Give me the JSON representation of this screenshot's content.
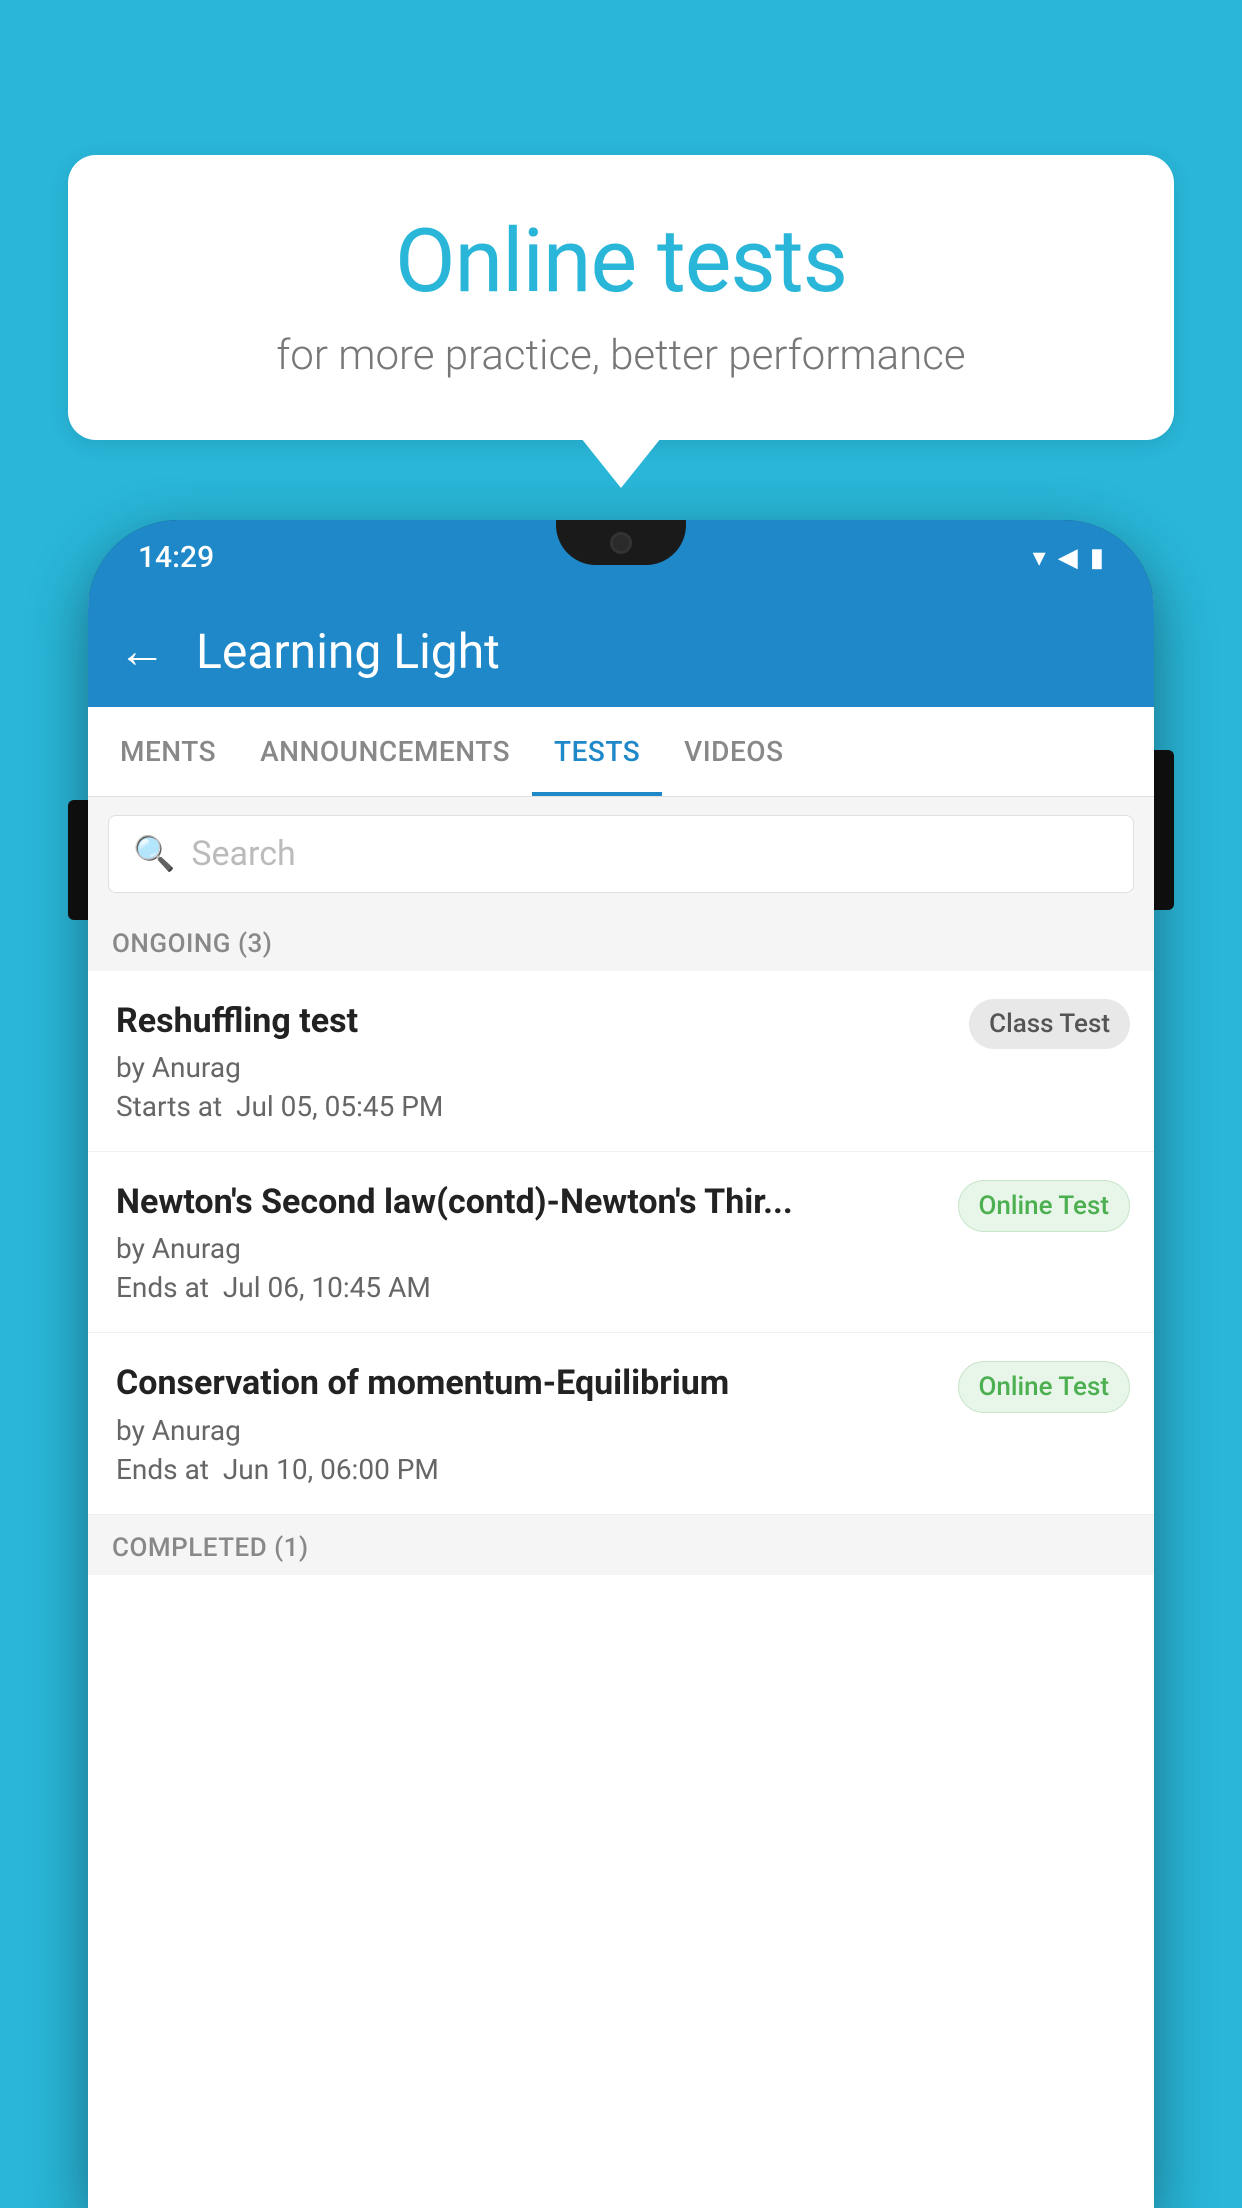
{
  "background": {
    "color": "#29b6d8"
  },
  "speech_bubble": {
    "title": "Online tests",
    "subtitle": "for more practice, better performance"
  },
  "phone": {
    "status_bar": {
      "time": "14:29",
      "wifi": "▾",
      "signal": "▲",
      "battery": "▮"
    },
    "header": {
      "back_label": "←",
      "title": "Learning Light"
    },
    "tabs": [
      {
        "label": "MENTS",
        "active": false
      },
      {
        "label": "ANNOUNCEMENTS",
        "active": false
      },
      {
        "label": "TESTS",
        "active": true
      },
      {
        "label": "VIDEOS",
        "active": false
      }
    ],
    "search": {
      "placeholder": "Search",
      "icon": "🔍"
    },
    "ongoing_section": {
      "label": "ONGOING (3)"
    },
    "test_items": [
      {
        "name": "Reshuffling test",
        "author": "by Anurag",
        "date_label": "Starts at",
        "date": "Jul 05, 05:45 PM",
        "badge": "Class Test",
        "badge_type": "class"
      },
      {
        "name": "Newton's Second law(contd)-Newton's Thir...",
        "author": "by Anurag",
        "date_label": "Ends at",
        "date": "Jul 06, 10:45 AM",
        "badge": "Online Test",
        "badge_type": "online"
      },
      {
        "name": "Conservation of momentum-Equilibrium",
        "author": "by Anurag",
        "date_label": "Ends at",
        "date": "Jun 10, 06:00 PM",
        "badge": "Online Test",
        "badge_type": "online"
      }
    ],
    "completed_section": {
      "label": "COMPLETED (1)"
    }
  }
}
